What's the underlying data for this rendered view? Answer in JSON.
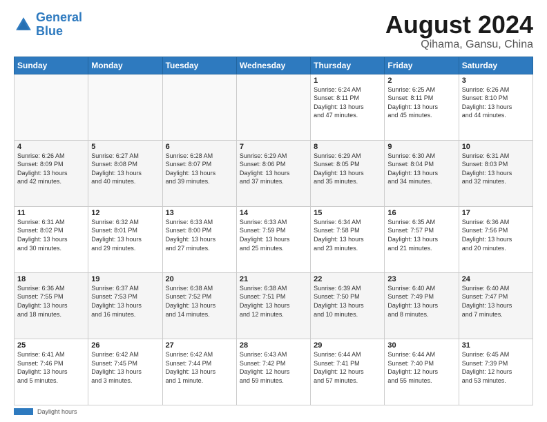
{
  "logo": {
    "line1": "General",
    "line2": "Blue"
  },
  "title": "August 2024",
  "subtitle": "Qihama, Gansu, China",
  "header_days": [
    "Sunday",
    "Monday",
    "Tuesday",
    "Wednesday",
    "Thursday",
    "Friday",
    "Saturday"
  ],
  "footer_label": "Daylight hours",
  "weeks": [
    [
      {
        "day": "",
        "info": ""
      },
      {
        "day": "",
        "info": ""
      },
      {
        "day": "",
        "info": ""
      },
      {
        "day": "",
        "info": ""
      },
      {
        "day": "1",
        "info": "Sunrise: 6:24 AM\nSunset: 8:11 PM\nDaylight: 13 hours\nand 47 minutes."
      },
      {
        "day": "2",
        "info": "Sunrise: 6:25 AM\nSunset: 8:11 PM\nDaylight: 13 hours\nand 45 minutes."
      },
      {
        "day": "3",
        "info": "Sunrise: 6:26 AM\nSunset: 8:10 PM\nDaylight: 13 hours\nand 44 minutes."
      }
    ],
    [
      {
        "day": "4",
        "info": "Sunrise: 6:26 AM\nSunset: 8:09 PM\nDaylight: 13 hours\nand 42 minutes."
      },
      {
        "day": "5",
        "info": "Sunrise: 6:27 AM\nSunset: 8:08 PM\nDaylight: 13 hours\nand 40 minutes."
      },
      {
        "day": "6",
        "info": "Sunrise: 6:28 AM\nSunset: 8:07 PM\nDaylight: 13 hours\nand 39 minutes."
      },
      {
        "day": "7",
        "info": "Sunrise: 6:29 AM\nSunset: 8:06 PM\nDaylight: 13 hours\nand 37 minutes."
      },
      {
        "day": "8",
        "info": "Sunrise: 6:29 AM\nSunset: 8:05 PM\nDaylight: 13 hours\nand 35 minutes."
      },
      {
        "day": "9",
        "info": "Sunrise: 6:30 AM\nSunset: 8:04 PM\nDaylight: 13 hours\nand 34 minutes."
      },
      {
        "day": "10",
        "info": "Sunrise: 6:31 AM\nSunset: 8:03 PM\nDaylight: 13 hours\nand 32 minutes."
      }
    ],
    [
      {
        "day": "11",
        "info": "Sunrise: 6:31 AM\nSunset: 8:02 PM\nDaylight: 13 hours\nand 30 minutes."
      },
      {
        "day": "12",
        "info": "Sunrise: 6:32 AM\nSunset: 8:01 PM\nDaylight: 13 hours\nand 29 minutes."
      },
      {
        "day": "13",
        "info": "Sunrise: 6:33 AM\nSunset: 8:00 PM\nDaylight: 13 hours\nand 27 minutes."
      },
      {
        "day": "14",
        "info": "Sunrise: 6:33 AM\nSunset: 7:59 PM\nDaylight: 13 hours\nand 25 minutes."
      },
      {
        "day": "15",
        "info": "Sunrise: 6:34 AM\nSunset: 7:58 PM\nDaylight: 13 hours\nand 23 minutes."
      },
      {
        "day": "16",
        "info": "Sunrise: 6:35 AM\nSunset: 7:57 PM\nDaylight: 13 hours\nand 21 minutes."
      },
      {
        "day": "17",
        "info": "Sunrise: 6:36 AM\nSunset: 7:56 PM\nDaylight: 13 hours\nand 20 minutes."
      }
    ],
    [
      {
        "day": "18",
        "info": "Sunrise: 6:36 AM\nSunset: 7:55 PM\nDaylight: 13 hours\nand 18 minutes."
      },
      {
        "day": "19",
        "info": "Sunrise: 6:37 AM\nSunset: 7:53 PM\nDaylight: 13 hours\nand 16 minutes."
      },
      {
        "day": "20",
        "info": "Sunrise: 6:38 AM\nSunset: 7:52 PM\nDaylight: 13 hours\nand 14 minutes."
      },
      {
        "day": "21",
        "info": "Sunrise: 6:38 AM\nSunset: 7:51 PM\nDaylight: 13 hours\nand 12 minutes."
      },
      {
        "day": "22",
        "info": "Sunrise: 6:39 AM\nSunset: 7:50 PM\nDaylight: 13 hours\nand 10 minutes."
      },
      {
        "day": "23",
        "info": "Sunrise: 6:40 AM\nSunset: 7:49 PM\nDaylight: 13 hours\nand 8 minutes."
      },
      {
        "day": "24",
        "info": "Sunrise: 6:40 AM\nSunset: 7:47 PM\nDaylight: 13 hours\nand 7 minutes."
      }
    ],
    [
      {
        "day": "25",
        "info": "Sunrise: 6:41 AM\nSunset: 7:46 PM\nDaylight: 13 hours\nand 5 minutes."
      },
      {
        "day": "26",
        "info": "Sunrise: 6:42 AM\nSunset: 7:45 PM\nDaylight: 13 hours\nand 3 minutes."
      },
      {
        "day": "27",
        "info": "Sunrise: 6:42 AM\nSunset: 7:44 PM\nDaylight: 13 hours\nand 1 minute."
      },
      {
        "day": "28",
        "info": "Sunrise: 6:43 AM\nSunset: 7:42 PM\nDaylight: 12 hours\nand 59 minutes."
      },
      {
        "day": "29",
        "info": "Sunrise: 6:44 AM\nSunset: 7:41 PM\nDaylight: 12 hours\nand 57 minutes."
      },
      {
        "day": "30",
        "info": "Sunrise: 6:44 AM\nSunset: 7:40 PM\nDaylight: 12 hours\nand 55 minutes."
      },
      {
        "day": "31",
        "info": "Sunrise: 6:45 AM\nSunset: 7:39 PM\nDaylight: 12 hours\nand 53 minutes."
      }
    ]
  ]
}
